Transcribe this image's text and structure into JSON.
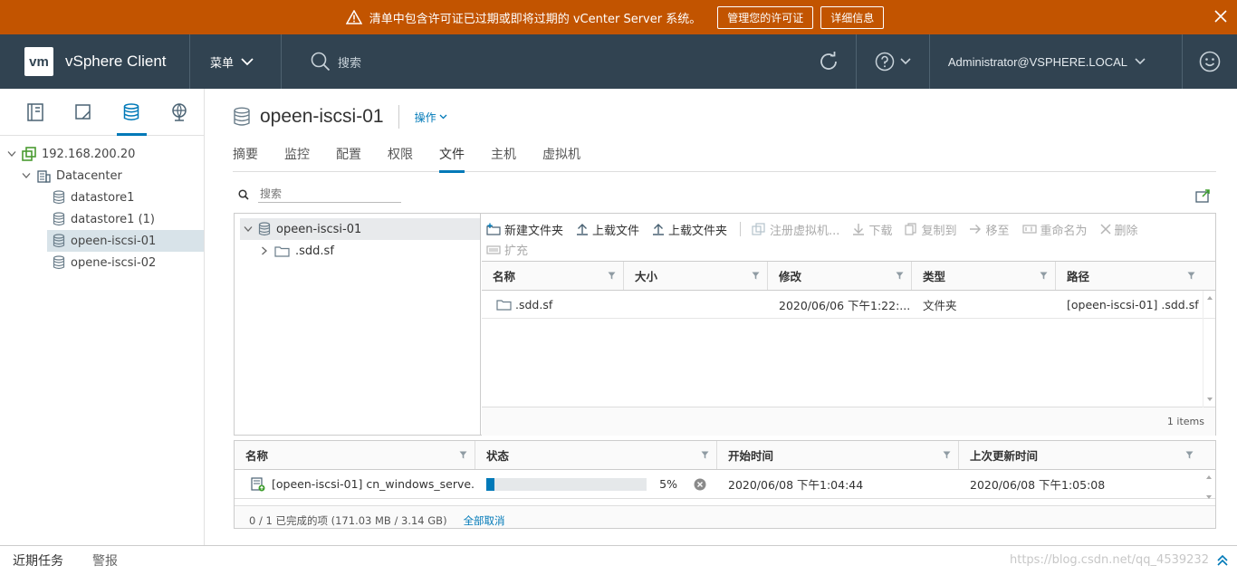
{
  "banner": {
    "message": "清单中包含许可证已过期或即将过期的 vCenter Server 系统。",
    "manage_label": "管理您的许可证",
    "details_label": "详细信息"
  },
  "header": {
    "logo": "vm",
    "app_title": "vSphere Client",
    "menu_label": "菜单",
    "search_placeholder": "搜索",
    "user": "Administrator@VSPHERE.LOCAL"
  },
  "sidebar": {
    "tree": [
      {
        "label": "192.168.200.20"
      },
      {
        "label": "Datacenter"
      },
      {
        "label": "datastore1"
      },
      {
        "label": "datastore1 (1)"
      },
      {
        "label": "opeen-iscsi-01"
      },
      {
        "label": "opene-iscsi-02"
      }
    ]
  },
  "main": {
    "title": "opeen-iscsi-01",
    "actions_label": "操作",
    "tabs": [
      "摘要",
      "监控",
      "配置",
      "权限",
      "文件",
      "主机",
      "虚拟机"
    ],
    "search_placeholder": "搜索"
  },
  "files": {
    "tree": [
      {
        "label": "opeen-iscsi-01"
      },
      {
        "label": ".sdd.sf"
      }
    ],
    "toolbar": {
      "new_folder": "新建文件夹",
      "upload_file": "上载文件",
      "upload_folder": "上载文件夹",
      "register_vm": "注册虚拟机...",
      "download": "下载",
      "copy_to": "复制到",
      "move_to": "移至",
      "rename": "重命名为",
      "delete": "删除",
      "inflate": "扩充"
    },
    "columns": [
      "名称",
      "大小",
      "修改",
      "类型",
      "路径"
    ],
    "rows": [
      {
        "name": ".sdd.sf",
        "size": "",
        "modified": "2020/06/06 下午1:22:...",
        "type": "文件夹",
        "path": "[opeen-iscsi-01] .sdd.sf"
      }
    ],
    "count": "1 items"
  },
  "tasks": {
    "columns": [
      "名称",
      "状态",
      "开始时间",
      "上次更新时间"
    ],
    "rows": [
      {
        "name": "[opeen-iscsi-01] cn_windows_serve...",
        "progress": 5,
        "progress_label": "5%",
        "start": "2020/06/08 下午1:04:44",
        "updated": "2020/06/08 下午1:05:08"
      }
    ],
    "summary": "0 / 1 已完成的项 (171.03 MB / 3.14 GB)",
    "cancel_all": "全部取消"
  },
  "bottom": {
    "recent_tasks": "近期任务",
    "alarms": "警报",
    "watermark": "https://blog.csdn.net/qq_4539232"
  },
  "colors": {
    "banner": "#c25400",
    "header": "#314351",
    "accent": "#0079b8"
  }
}
